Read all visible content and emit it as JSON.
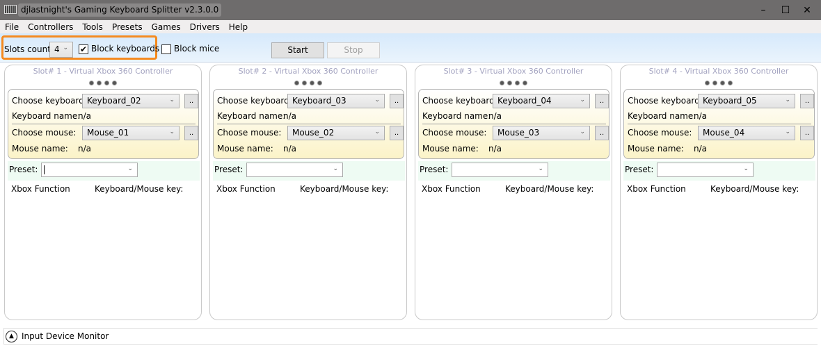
{
  "window": {
    "title": "djlastnight's Gaming Keyboard Splitter v2.3.0.0",
    "minimize": "–",
    "maximize": "☐",
    "close": "✕"
  },
  "menu": [
    "File",
    "Controllers",
    "Tools",
    "Presets",
    "Games",
    "Drivers",
    "Help"
  ],
  "toolbar": {
    "slots_label": "Slots count:",
    "slots_value": "4",
    "block_keyboards": "Block keyboards",
    "block_keyboards_checked": true,
    "block_mice": "Block mice",
    "block_mice_checked": false,
    "start": "Start",
    "stop": "Stop",
    "highlight_color": "#f58a1f"
  },
  "common": {
    "choose_keyboard": "Choose keyboard:",
    "keyboard_name": "Keyboard name:",
    "choose_mouse": "Choose mouse:",
    "mouse_name": "Mouse name:",
    "browse": "..",
    "preset": "Preset:",
    "xbox_function": "Xbox Function",
    "key_header": "Keyboard/Mouse key:"
  },
  "slots": [
    {
      "title": "Slot# 1 - Virtual Xbox 360 Controller",
      "keyboard": "Keyboard_02",
      "keyboard_name": "n/a",
      "mouse": "Mouse_01",
      "mouse_name": "n/a",
      "preset": ""
    },
    {
      "title": "Slot# 2 - Virtual Xbox 360 Controller",
      "keyboard": "Keyboard_03",
      "keyboard_name": "n/a",
      "mouse": "Mouse_02",
      "mouse_name": "n/a",
      "preset": ""
    },
    {
      "title": "Slot# 3 - Virtual Xbox 360 Controller",
      "keyboard": "Keyboard_04",
      "keyboard_name": "n/a",
      "mouse": "Mouse_03",
      "mouse_name": "n/a",
      "preset": ""
    },
    {
      "title": "Slot# 4 - Virtual Xbox 360 Controller",
      "keyboard": "Keyboard_05",
      "keyboard_name": "n/a",
      "mouse": "Mouse_04",
      "mouse_name": "n/a",
      "preset": ""
    }
  ],
  "footer": {
    "label": "Input Device Monitor"
  }
}
